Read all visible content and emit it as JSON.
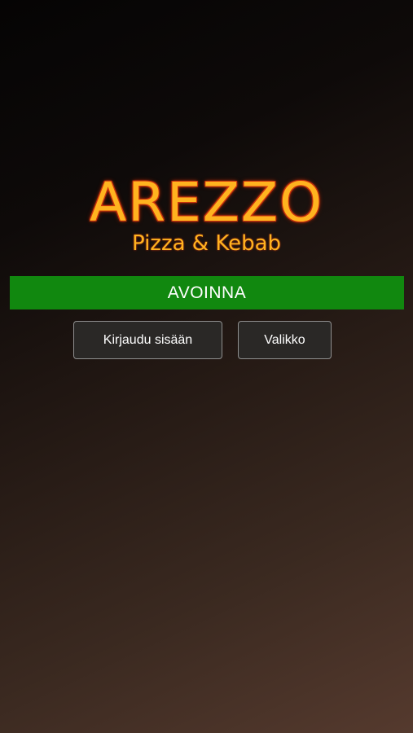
{
  "logo": {
    "name": "AREZZO",
    "tagline": "Pizza & Kebab"
  },
  "status": {
    "label": "AVOINNA",
    "color": "#11880f"
  },
  "actions": {
    "login_label": "Kirjaudu sisään",
    "menu_label": "Valikko"
  },
  "colors": {
    "brand": "#ffb31f",
    "brand_outline": "#c43610"
  }
}
